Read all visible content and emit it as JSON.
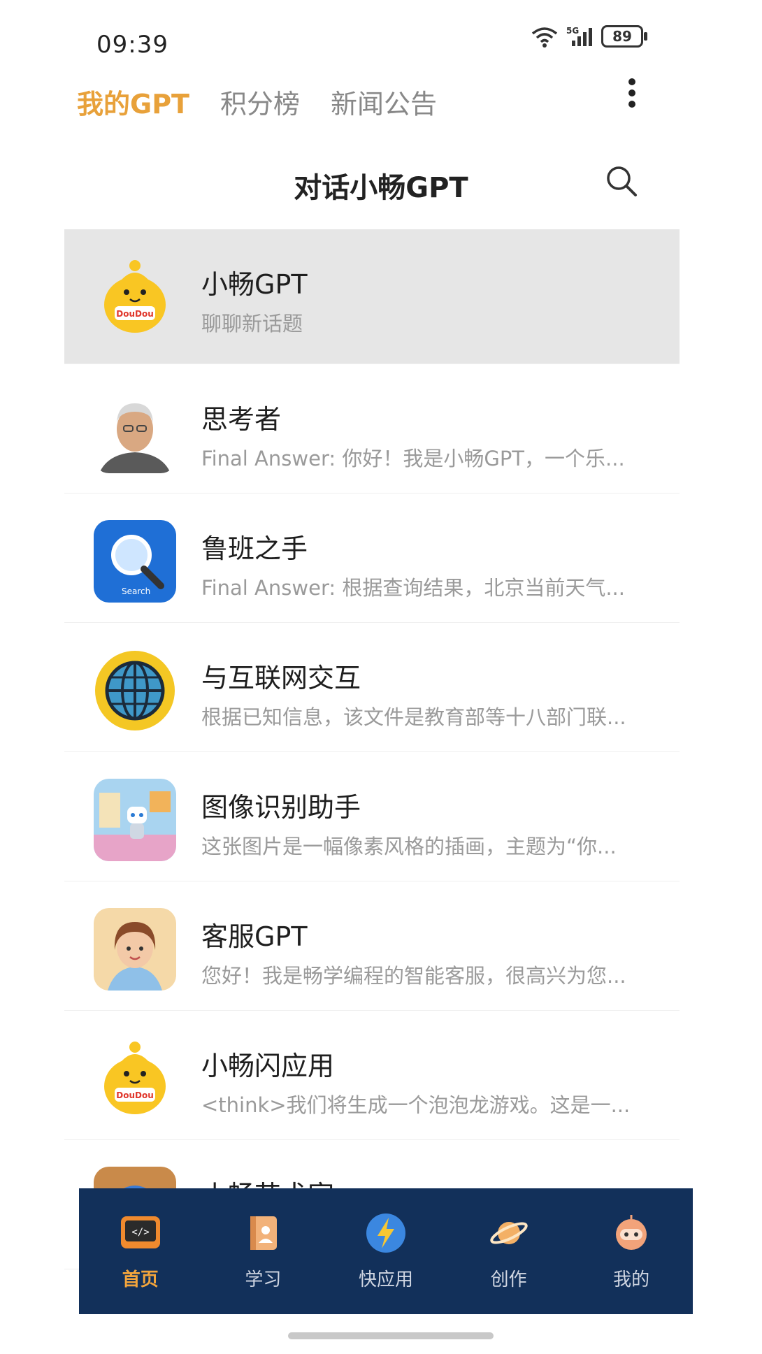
{
  "status": {
    "time": "09:39",
    "battery": "89"
  },
  "top_tabs": [
    {
      "label": "我的GPT",
      "active": true
    },
    {
      "label": "积分榜",
      "active": false
    },
    {
      "label": "新闻公告",
      "active": false
    }
  ],
  "header": {
    "title": "对话小畅GPT"
  },
  "chats": [
    {
      "title": "小畅GPT",
      "subtitle": "聊聊新话题",
      "avatar": "yellow-mascot-avatar"
    },
    {
      "title": "思考者",
      "subtitle": "Final Answer: 你好！我是小畅GPT，一个乐...",
      "avatar": "elderly-man-avatar"
    },
    {
      "title": "鲁班之手",
      "subtitle": "Final Answer: 根据查询结果，北京当前天气...",
      "avatar": "search-magnifier-avatar"
    },
    {
      "title": "与互联网交互",
      "subtitle": "根据已知信息，该文件是教育部等十八部门联...",
      "avatar": "globe-avatar"
    },
    {
      "title": "图像识别助手",
      "subtitle": "这张图片是一幅像素风格的插画，主题为“你...",
      "avatar": "robot-room-avatar"
    },
    {
      "title": "客服GPT",
      "subtitle": "您好！我是畅学编程的智能客服，很高兴为您...",
      "avatar": "service-girl-avatar"
    },
    {
      "title": "小畅闪应用",
      "subtitle": "<think>我们将生成一个泡泡龙游戏。这是一...",
      "avatar": "yellow-mascot-avatar"
    },
    {
      "title": "小畅艺术家",
      "subtitle": "",
      "avatar": "artist-avatar"
    }
  ],
  "bottom_nav": [
    {
      "label": "首页",
      "icon": "code-window-icon",
      "active": true
    },
    {
      "label": "学习",
      "icon": "book-icon",
      "active": false
    },
    {
      "label": "快应用",
      "icon": "lightning-icon",
      "active": false
    },
    {
      "label": "创作",
      "icon": "planet-icon",
      "active": false
    },
    {
      "label": "我的",
      "icon": "robot-face-icon",
      "active": false
    }
  ],
  "colors": {
    "accent": "#e8a13a",
    "nav_bg": "#12305a",
    "selected_bg": "#e6e6e6"
  }
}
